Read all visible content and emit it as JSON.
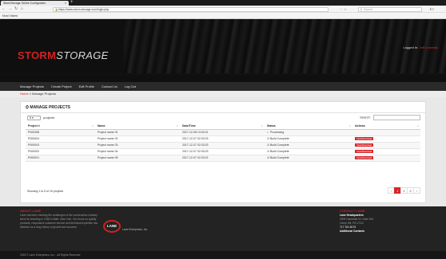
{
  "browser": {
    "tab_title": "StormStorage Online Configurator",
    "tab_close": "×",
    "new_tab": "+",
    "url": "https://www.storm-storage.com/login.php",
    "search_placeholder": "Search",
    "bookmark": "Most Visited",
    "icons": [
      "back-icon",
      "forward-icon",
      "reload-icon",
      "home-icon",
      "lock-icon",
      "star-icon",
      "search-icon",
      "menu-icon"
    ]
  },
  "header": {
    "logo_part1": "STORM",
    "logo_part2": "STORAGE",
    "logged_in_label": "Logged In:",
    "logged_in_user": "Jeff Lowenby",
    "nav": [
      "Manage Projects",
      "Create Project",
      "Edit Profile",
      "Contact Us",
      "Log Out"
    ]
  },
  "breadcrumb": {
    "home": "Home",
    "sep": " » ",
    "current": "Manage Projects"
  },
  "panel": {
    "title": "MANAGE PROJECTS",
    "length_value": "5",
    "length_suffix": "projects",
    "search_label": "Search:",
    "columns": [
      "Project #",
      "Name",
      "Date/Time",
      "Status",
      "Actions"
    ],
    "rows": [
      {
        "num": "P000268",
        "name": "Project name 01",
        "date": "2017-12-08 13:32:01",
        "status": "Processing",
        "status_icon": "○",
        "action": ""
      },
      {
        "num": "P000004",
        "name": "Project name 02",
        "date": "2017-12-07 02:33:23",
        "status": "Build Complete",
        "status_icon": "☑",
        "action": "View/Download"
      },
      {
        "num": "P000003",
        "name": "Project name 03",
        "date": "2017-12-07 02:33:23",
        "status": "Build Complete",
        "status_icon": "☑",
        "action": "View/Download"
      },
      {
        "num": "P000002",
        "name": "Project name 04",
        "date": "2017-12-07 02:33:23",
        "status": "Build Complete",
        "status_icon": "☑",
        "action": "View/Download"
      },
      {
        "num": "P000001",
        "name": "Project name 05",
        "date": "2017-12-07 02:33:22",
        "status": "Build Complete",
        "status_icon": "☑",
        "action": "View/Download"
      }
    ],
    "showing": "Showing 1 to 5 of 15 projects",
    "pages": [
      "‹",
      "1",
      "2",
      "3",
      "›"
    ],
    "active_page": "1"
  },
  "footer": {
    "about_title": "ABOUT LANE",
    "about_text": "Lane has been meeting the challenges of the construction industry since its founding in 1936 in Bath, New York. Our focus on quality products, responsive customer service and technical expertise has afforded us a long history of growth and success.",
    "logo_text": "LANE",
    "logo_caption": "Lane Enterprises, Inc.",
    "contact_title": "CONTACT LANE",
    "hq_label": "Lane Headquarters",
    "address1": "3905 Hartzdale Dr. Suite 514",
    "address2": "Camp Hill, PA 17011",
    "phone": "717.761.8175",
    "more_contacts": "Additional Contacts",
    "copyright": "2018 © Lane Enterprises, Inc. - All Rights Reserved"
  },
  "colors": {
    "brand_red": "#d32020",
    "button_red": "#d9252a",
    "header_bg": "#0f0f0f",
    "nav_bg": "#2a2a2a"
  }
}
